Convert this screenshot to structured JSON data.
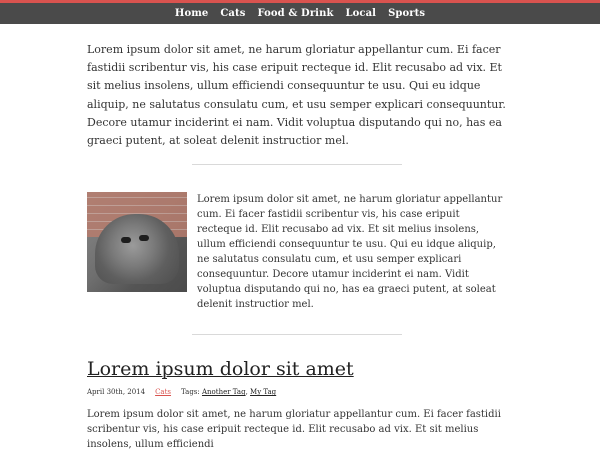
{
  "nav": {
    "items": [
      "Home",
      "Cats",
      "Food & Drink",
      "Local",
      "Sports"
    ]
  },
  "intro": {
    "text": "Lorem ipsum dolor sit amet, ne harum gloriatur appellantur cum. Ei facer fastidii scribentur vis, his case eripuit recteque id. Elit recusabo ad vix. Et sit melius insolens, ullum efficiendi consequuntur te usu. Qui eu idque aliquip, ne salutatus consulatu cum, et usu semper explicari consequuntur. Decore utamur inciderint ei nam. Vidit voluptua disputando qui no, has ea graeci putent, at soleat delenit instructior mel."
  },
  "media": {
    "image_alt": "gray cat lying on its side",
    "text": "Lorem ipsum dolor sit amet, ne harum gloriatur appellantur cum. Ei facer fastidii scribentur vis, his case eripuit recteque id. Elit recusabo ad vix. Et sit melius insolens, ullum efficiendi consequuntur te usu. Qui eu idque aliquip, ne salutatus consulatu cum, et usu semper explicari consequuntur. Decore utamur inciderint ei nam. Vidit voluptua disputando qui no, has ea graeci putent, at soleat delenit instructior mel."
  },
  "post": {
    "title": "Lorem ipsum dolor sit amet",
    "date": "April 30th, 2014",
    "category": "Cats",
    "tags_label": "Tags:",
    "tags": [
      "Another Tag",
      "My Tag"
    ],
    "body": "Lorem ipsum dolor sit amet, ne harum gloriatur appellantur cum. Ei facer fastidii scribentur vis, his case eripuit recteque id. Elit recusabo ad vix. Et sit melius insolens, ullum efficiendi"
  },
  "colors": {
    "accent": "#d9534f",
    "nav_bg": "#4a4a4a"
  }
}
